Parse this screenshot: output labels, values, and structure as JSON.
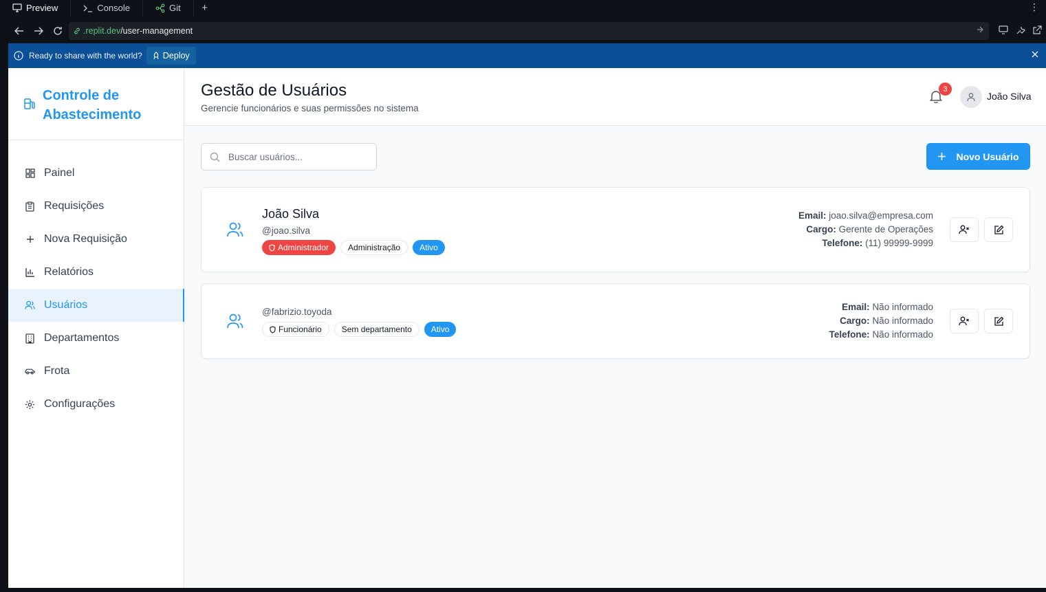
{
  "ide": {
    "tabs": [
      {
        "label": "Preview",
        "icon": "monitor-icon"
      },
      {
        "label": "Console",
        "icon": "terminal-icon"
      },
      {
        "label": "Git",
        "icon": "git-branch-icon"
      }
    ],
    "url_host": ".replit.dev",
    "url_path": "/user-management"
  },
  "banner": {
    "message": "Ready to share with the world?",
    "deploy_label": "Deploy"
  },
  "sidebar": {
    "brand": "Controle de Abastecimento",
    "items": [
      {
        "label": "Painel",
        "icon": "dashboard-icon"
      },
      {
        "label": "Requisições",
        "icon": "clipboard-icon"
      },
      {
        "label": "Nova Requisição",
        "icon": "plus-icon"
      },
      {
        "label": "Relatórios",
        "icon": "bar-chart-icon"
      },
      {
        "label": "Usuários",
        "icon": "users-icon",
        "active": true
      },
      {
        "label": "Departamentos",
        "icon": "building-icon"
      },
      {
        "label": "Frota",
        "icon": "car-icon"
      },
      {
        "label": "Configurações",
        "icon": "gear-icon"
      }
    ]
  },
  "header": {
    "title": "Gestão de Usuários",
    "subtitle": "Gerencie funcionários e suas permissões no sistema",
    "notifications": "3",
    "user": "João Silva"
  },
  "toolbar": {
    "search_placeholder": "Buscar usuários...",
    "new_user_label": "Novo Usuário"
  },
  "users": [
    {
      "name": "João Silva",
      "handle": "@joao.silva",
      "role": "Administrador",
      "department": "Administração",
      "status": "Ativo",
      "email_label": "Email:",
      "email": "joao.silva@empresa.com",
      "cargo_label": "Cargo:",
      "cargo": "Gerente de Operações",
      "phone_label": "Telefone:",
      "phone": "(11) 99999-9999"
    },
    {
      "name": "",
      "handle": "@fabrizio.toyoda",
      "role": "Funcionário",
      "department": "Sem departamento",
      "status": "Ativo",
      "email_label": "Email:",
      "email": "Não informado",
      "cargo_label": "Cargo:",
      "cargo": "Não informado",
      "phone_label": "Telefone:",
      "phone": "Não informado"
    }
  ],
  "colors": {
    "accent": "#2196f3",
    "admin_badge": "#ef4444",
    "banner": "#0b4f97"
  }
}
